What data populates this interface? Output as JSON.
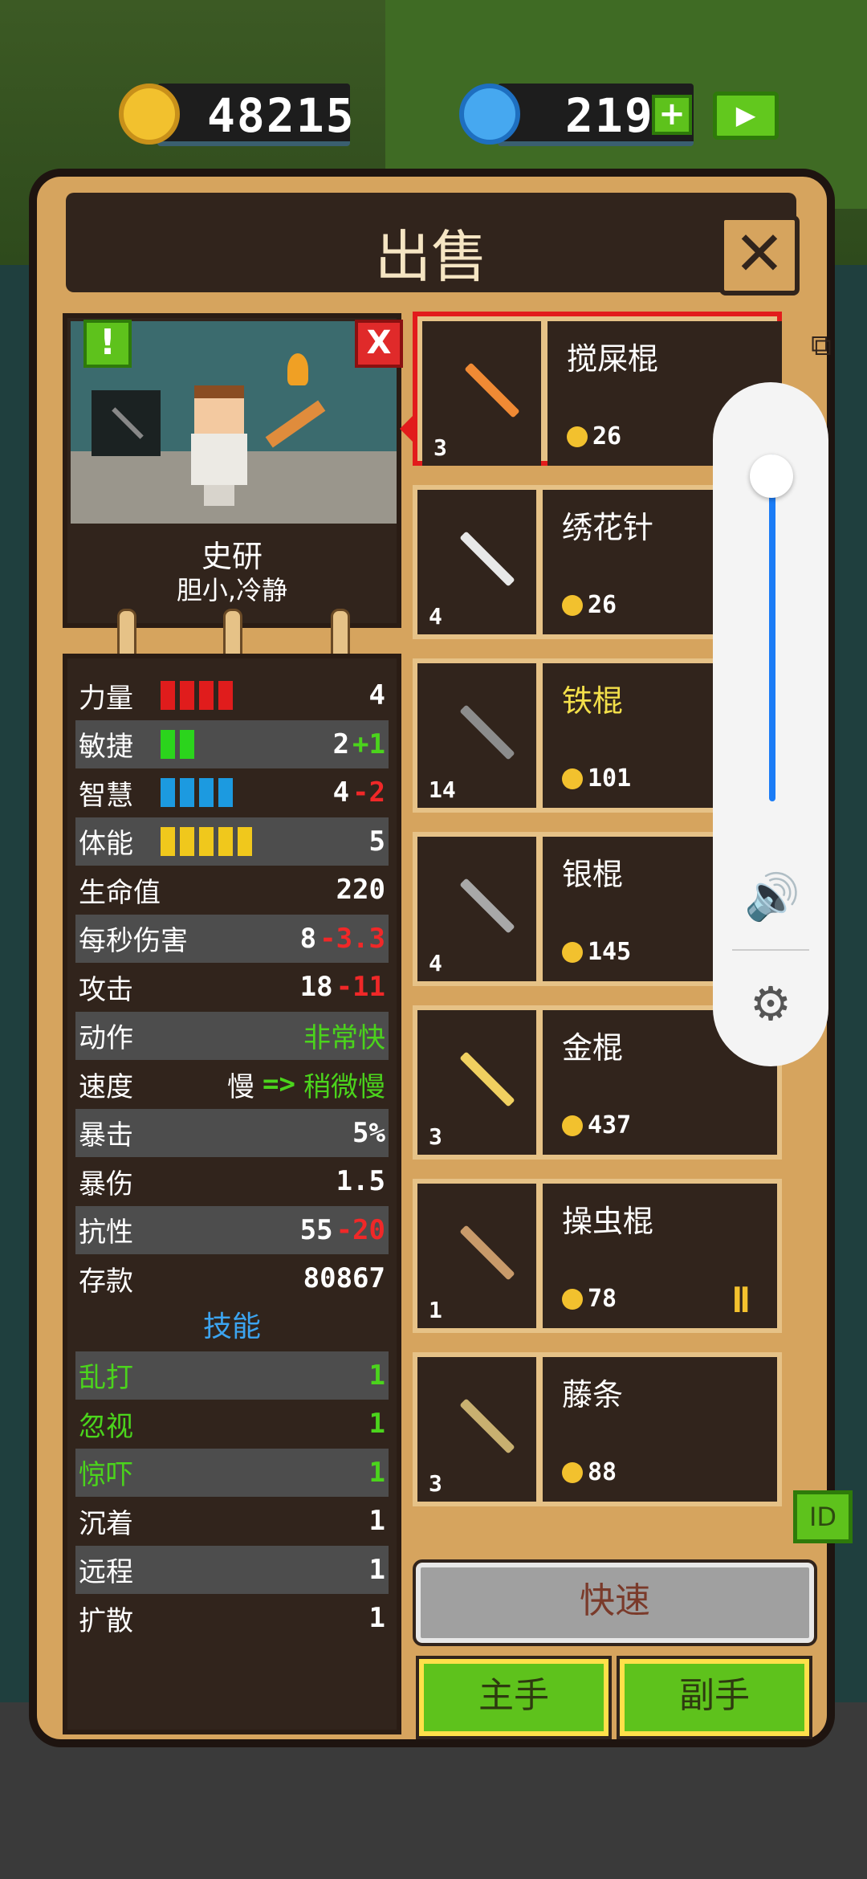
{
  "currency": {
    "coins": "48215",
    "gems": "219",
    "add_icon": "plus-icon",
    "video_icon": "video-reward-icon"
  },
  "dialog": {
    "title": "出售",
    "close_icon": "close-icon"
  },
  "character": {
    "name": "史研",
    "traits": "胆小,冷静",
    "alert_badge": "!",
    "dismiss_badge": "X"
  },
  "stats": [
    {
      "label": "力量",
      "value": "4",
      "bars": 4,
      "bar_color": "#e01c1c"
    },
    {
      "label": "敏捷",
      "value": "2",
      "bonus": "+1",
      "bonus_color": "green",
      "bars": 2,
      "bar_color": "#2bd41c"
    },
    {
      "label": "智慧",
      "value": "4",
      "bonus": "-2",
      "bonus_color": "red",
      "bars": 4,
      "bar_color": "#1c9ae0"
    },
    {
      "label": "体能",
      "value": "5",
      "bars": 5,
      "bar_color": "#f0c81c"
    },
    {
      "label": "生命值",
      "value": "220"
    },
    {
      "label": "每秒伤害",
      "value": "8",
      "bonus": "-3.3",
      "bonus_color": "red"
    },
    {
      "label": "攻击",
      "value": "18",
      "bonus": "-11",
      "bonus_color": "red"
    },
    {
      "label": "动作",
      "value": "非常快",
      "value_color": "green"
    },
    {
      "label": "速度",
      "value": "慢",
      "arrow": "=>",
      "value2": "稍微慢"
    },
    {
      "label": "暴击",
      "value": "5%"
    },
    {
      "label": "暴伤",
      "value": "1.5"
    },
    {
      "label": "抗性",
      "value": "55",
      "bonus": "-20",
      "bonus_color": "red"
    },
    {
      "label": "存款",
      "value": "80867"
    }
  ],
  "skills_title": "技能",
  "skills": [
    {
      "label": "乱打",
      "value": "1",
      "color": "green"
    },
    {
      "label": "忽视",
      "value": "1",
      "color": "green"
    },
    {
      "label": "惊吓",
      "value": "1",
      "color": "green"
    },
    {
      "label": "沉着",
      "value": "1",
      "color": "white"
    },
    {
      "label": "远程",
      "value": "1",
      "color": "white"
    },
    {
      "label": "扩散",
      "value": "1",
      "color": "white"
    }
  ],
  "items": [
    {
      "name": "搅屎棍",
      "price": "26",
      "qty": "3",
      "selected": true,
      "icon": "skewer-icon",
      "color": "#f08a34"
    },
    {
      "name": "绣花针",
      "price": "26",
      "qty": "4",
      "icon": "needle-icon",
      "color": "#e8e8e8"
    },
    {
      "name": "铁棍",
      "price": "101",
      "qty": "14",
      "name_color": "yellow",
      "icon": "iron-stick-icon",
      "color": "#8c8c8c"
    },
    {
      "name": "银棍",
      "price": "145",
      "qty": "4",
      "icon": "silver-stick-icon",
      "color": "#a8a8a8"
    },
    {
      "name": "金棍",
      "price": "437",
      "qty": "3",
      "icon": "gold-stick-icon",
      "color": "#f0d060"
    },
    {
      "name": "操虫棍",
      "price": "78",
      "qty": "1",
      "icon": "insect-staff-icon",
      "color": "#c89a6a",
      "equip": true
    },
    {
      "name": "藤条",
      "price": "88",
      "qty": "3",
      "icon": "rattan-icon",
      "color": "#c8b070"
    }
  ],
  "buttons": {
    "fast": "快速",
    "main_hand": "主手",
    "off_hand": "副手",
    "id": "ID"
  },
  "volume": {
    "level_percent": 95
  }
}
